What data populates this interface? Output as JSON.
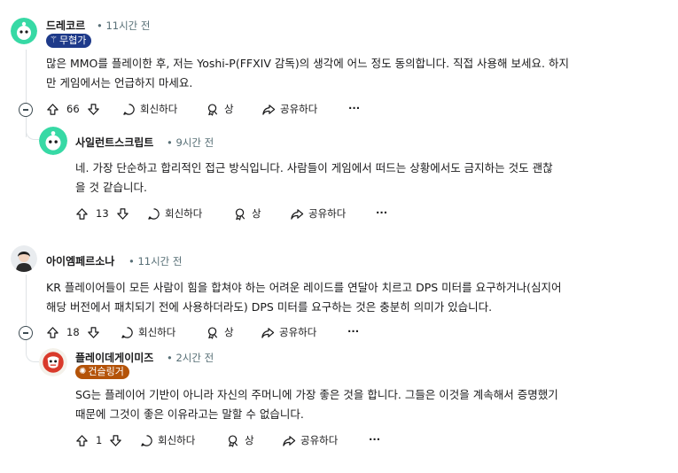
{
  "comments": [
    {
      "author": "드레코르",
      "time": "11시간 전",
      "flair": "무협가",
      "text_line1": "많은 MMO를 플레이한 후, 저는 Yoshi-P(FFXIV 감독)의 생각에 어느 정도 동의합니다. 직접 사용해 보세요. 하지",
      "text_line2": "만 게임에서는 언급하지 마세요.",
      "votes": "66",
      "reply": "회신하다",
      "award": "상",
      "share": "공유하다",
      "more": "···"
    },
    {
      "author": "사일런트스크립트",
      "time": "9시간 전",
      "text_line1": "네. 가장 단순하고 합리적인 접근 방식입니다. 사람들이 게임에서 떠드는 상황에서도 금지하는 것도 괜찮",
      "text_line2": "을 것 같습니다.",
      "votes": "13",
      "reply": "회신하다",
      "award": "상",
      "share": "공유하다",
      "more": "···"
    },
    {
      "author": "아이엠페르소나",
      "time": "11시간 전",
      "text_line1": "KR 플레이어들이 모든 사람이 힘을 합쳐야 하는 어려운 레이드를 연달아 치르고 DPS 미터를 요구하거나(심지어",
      "text_line2": "해당 버전에서 패치되기 전에 사용하더라도) DPS 미터를 요구하는 것은 충분히 의미가 있습니다.",
      "votes": "18",
      "reply": "회신하다",
      "award": "상",
      "share": "공유하다",
      "more": "···"
    },
    {
      "author": "플레이데게이미즈",
      "time": "2시간 전",
      "flair": "건슬링거",
      "text_line1": "SG는 플레이어 기반이 아니라 자신의 주머니에 가장 좋은 것을 합니다. 그들은 이것을 계속해서 증명했기",
      "text_line2": "때문에 그것이 좋은 이유라고는 말할 수 없습니다.",
      "votes": "1",
      "reply": "회신하다",
      "award": "상",
      "share": "공유하다",
      "more": "···"
    }
  ],
  "colors": {
    "flair1_bg": "#1e3a8a",
    "flair2_bg": "#b45309",
    "avatar1": "#37d9a5",
    "avatar2": "#37d9a5"
  },
  "icons": {
    "upvote": "upvote-arrow-icon",
    "downvote": "downvote-arrow-icon",
    "reply": "comment-bubble-icon",
    "award": "award-icon",
    "share": "share-arrow-icon",
    "collapse": "collapse-minus-icon"
  }
}
